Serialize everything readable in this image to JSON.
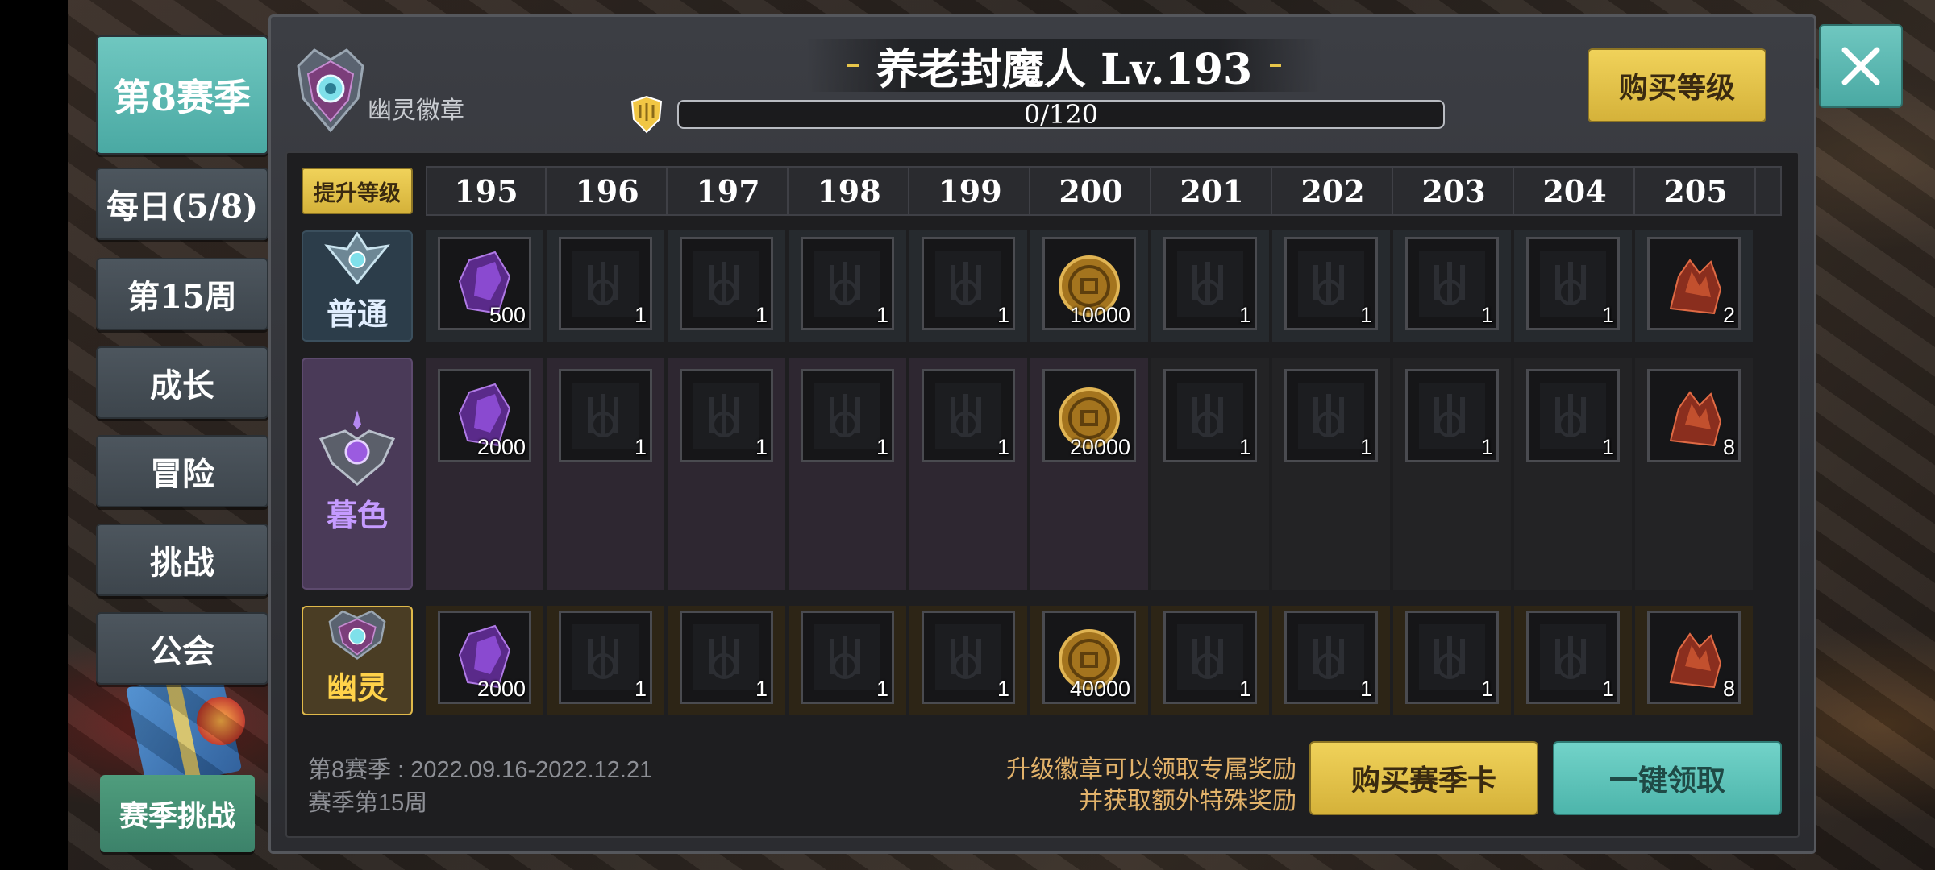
{
  "nav": {
    "season": "第8赛季",
    "daily": "每日(5/8)",
    "week": "第15周",
    "growth": "成长",
    "adventure": "冒险",
    "challenge": "挑战",
    "guild": "公会",
    "season_challenge": "赛季挑战"
  },
  "header": {
    "badge_name": "幽灵徽章",
    "title": "养老封魔人 Lv.193",
    "xp": "0/120",
    "buy_level": "购买等级"
  },
  "rewards": {
    "upgrade_tag": "提升等级",
    "levels": [
      "195",
      "196",
      "197",
      "198",
      "199",
      "200",
      "201",
      "202",
      "203",
      "204",
      "205"
    ],
    "tiers": {
      "normal": "普通",
      "dusk": "暮色",
      "ghost": "幽灵"
    },
    "normal_items": [
      {
        "type": "crystal",
        "count": "500"
      },
      {
        "type": "chest",
        "count": "1"
      },
      {
        "type": "chest",
        "count": "1"
      },
      {
        "type": "chest",
        "count": "1"
      },
      {
        "type": "chest",
        "count": "1"
      },
      {
        "type": "coin",
        "count": "10000"
      },
      {
        "type": "chest",
        "count": "1"
      },
      {
        "type": "chest",
        "count": "1"
      },
      {
        "type": "chest",
        "count": "1"
      },
      {
        "type": "chest",
        "count": "1"
      },
      {
        "type": "ore",
        "count": "2"
      }
    ],
    "dusk_items": [
      {
        "type": "crystal",
        "count": "2000"
      },
      {
        "type": "chest",
        "count": "1"
      },
      {
        "type": "chest",
        "count": "1"
      },
      {
        "type": "chest",
        "count": "1"
      },
      {
        "type": "chest",
        "count": "1"
      },
      {
        "type": "coin",
        "count": "20000"
      },
      {
        "type": "chest",
        "count": "1"
      },
      {
        "type": "chest",
        "count": "1"
      },
      {
        "type": "chest",
        "count": "1"
      },
      {
        "type": "chest",
        "count": "1"
      },
      {
        "type": "ore",
        "count": "8"
      }
    ],
    "ghost_items": [
      {
        "type": "crystal",
        "count": "2000"
      },
      {
        "type": "chest",
        "count": "1"
      },
      {
        "type": "chest",
        "count": "1"
      },
      {
        "type": "chest",
        "count": "1"
      },
      {
        "type": "chest",
        "count": "1"
      },
      {
        "type": "coin",
        "count": "40000"
      },
      {
        "type": "chest",
        "count": "1"
      },
      {
        "type": "chest",
        "count": "1"
      },
      {
        "type": "chest",
        "count": "1"
      },
      {
        "type": "chest",
        "count": "1"
      },
      {
        "type": "ore",
        "count": "8"
      }
    ]
  },
  "footer": {
    "season_range": "第8赛季 : 2022.09.16-2022.12.21",
    "season_week": "赛季第15周",
    "tip_line1": "升级徽章可以领取专属奖励",
    "tip_line2": "并获取额外特殊奖励",
    "buy_card": "购买赛季卡",
    "claim_all": "一键领取"
  },
  "colors": {
    "accent_teal": "#5bbdb5",
    "accent_gold": "#e6c44a",
    "dusk_purple": "#c59bff",
    "ghost_gold": "#ffd24a"
  },
  "progress": {
    "xp_fraction": 0
  }
}
